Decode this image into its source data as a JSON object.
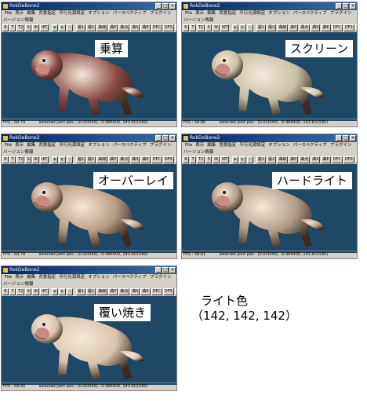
{
  "window": {
    "title": "RokDeBone2",
    "menu": [
      "File",
      "表示",
      "編集",
      "背景指定",
      "平行光源設定",
      "オプション",
      "パースペクティブ",
      "プラグイン"
    ],
    "menu2": "バージョン情報",
    "toolbar": [
      "R",
      "T",
      "T2",
      "S",
      "IK",
      "IKT",
      "▶",
      "◐",
      "◇",
      "履1",
      "履2",
      "曲線",
      "曲P",
      "曲点",
      "曲S",
      "曲E",
      "DFC",
      "DFS",
      "DFC"
    ],
    "minimize": "_",
    "maximize": "□",
    "close": "×",
    "status_joint": "selected joint pos : (0.000000, -0.486400, 143.601580)"
  },
  "panels": [
    {
      "label": "乗算",
      "fps": "FPS : 58.79",
      "tint": "#8a4a44"
    },
    {
      "label": "スクリーン",
      "fps": "FPS : 58.80",
      "tint": "#c8c0a4"
    },
    {
      "label": "オーバーレイ",
      "fps": "FPS : 58.78",
      "tint": "#b89a80"
    },
    {
      "label": "ハードライト",
      "fps": "FPS : 58.81",
      "tint": "#b09c86"
    },
    {
      "label": "覆い焼き",
      "fps": "FPS : 58.80",
      "tint": "#d8c4ae"
    }
  ],
  "note": {
    "line1": "ライト色",
    "line2": "（142, 142, 142）",
    "light_color": "#8e8e8e"
  }
}
